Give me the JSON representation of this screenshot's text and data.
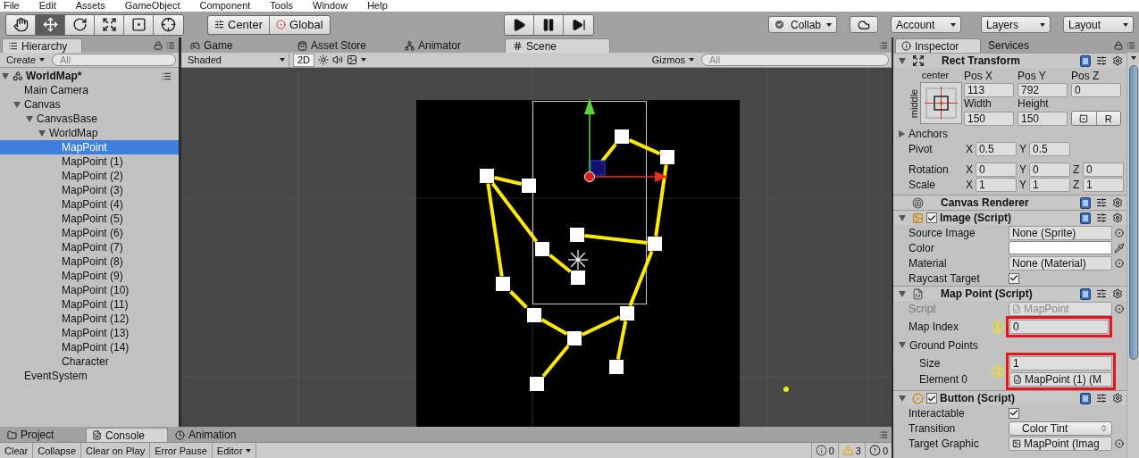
{
  "menu": [
    "File",
    "Edit",
    "Assets",
    "GameObject",
    "Component",
    "Tools",
    "Window",
    "Help"
  ],
  "toolbar": {
    "tools": [
      {
        "kind": "hand",
        "selected": false
      },
      {
        "kind": "move",
        "selected": true
      },
      {
        "kind": "rotate",
        "selected": false
      },
      {
        "kind": "scale",
        "selected": false
      },
      {
        "kind": "rect",
        "selected": false
      },
      {
        "kind": "transform",
        "selected": false
      }
    ],
    "pivot_mode": "Center",
    "pivot_rotation": "Global",
    "collab": "Collab",
    "account": "Account",
    "layers": "Layers",
    "layout": "Layout"
  },
  "hierarchy": {
    "tab": "Hierarchy",
    "create": "Create",
    "search_placeholder": "All",
    "tree": [
      {
        "label": "WorldMap*",
        "kind": "scene",
        "selected": false,
        "expanded": true,
        "children": [
          {
            "label": "Main Camera",
            "selected": false
          },
          {
            "label": "Canvas",
            "selected": false,
            "expanded": true,
            "children": [
              {
                "label": "CanvasBase",
                "selected": false,
                "expanded": true,
                "children": [
                  {
                    "label": "WorldMap",
                    "selected": false,
                    "expanded": true,
                    "children": [
                      {
                        "label": "MapPoint",
                        "selected": true
                      },
                      {
                        "label": "MapPoint (1)",
                        "selected": false
                      },
                      {
                        "label": "MapPoint (2)",
                        "selected": false
                      },
                      {
                        "label": "MapPoint (3)",
                        "selected": false
                      },
                      {
                        "label": "MapPoint (4)",
                        "selected": false
                      },
                      {
                        "label": "MapPoint (5)",
                        "selected": false
                      },
                      {
                        "label": "MapPoint (6)",
                        "selected": false
                      },
                      {
                        "label": "MapPoint (7)",
                        "selected": false
                      },
                      {
                        "label": "MapPoint (8)",
                        "selected": false
                      },
                      {
                        "label": "MapPoint (9)",
                        "selected": false
                      },
                      {
                        "label": "MapPoint (10)",
                        "selected": false
                      },
                      {
                        "label": "MapPoint (11)",
                        "selected": false
                      },
                      {
                        "label": "MapPoint (12)",
                        "selected": false
                      },
                      {
                        "label": "MapPoint (13)",
                        "selected": false
                      },
                      {
                        "label": "MapPoint (14)",
                        "selected": false
                      },
                      {
                        "label": "Character",
                        "selected": false
                      }
                    ]
                  }
                ]
              }
            ]
          },
          {
            "label": "EventSystem",
            "selected": false
          }
        ]
      }
    ]
  },
  "scene": {
    "tabs": [
      {
        "label": "Game",
        "kind": "game",
        "selected": false
      },
      {
        "label": "Asset Store",
        "kind": "store",
        "selected": false
      },
      {
        "label": "Animator",
        "kind": "animator",
        "selected": false
      },
      {
        "label": "Scene",
        "kind": "scene",
        "selected": true
      }
    ],
    "shading": "Shaded",
    "mode_2d": {
      "label": "2D",
      "on": true
    },
    "gizmos": "Gizmos",
    "search_placeholder": "All"
  },
  "inspector": {
    "tabs": [
      {
        "label": "Inspector",
        "selected": true
      },
      {
        "label": "Services",
        "selected": false
      }
    ],
    "rect_transform": {
      "title": "Rect Transform",
      "anchor_horizontal": "center",
      "anchor_vertical": "middle",
      "fields": [
        {
          "label": "Pos X",
          "value": "113"
        },
        {
          "label": "Pos Y",
          "value": "792"
        },
        {
          "label": "Pos Z",
          "value": "0"
        },
        {
          "label": "Width",
          "value": "150"
        },
        {
          "label": "Height",
          "value": "150"
        }
      ],
      "reset_button": "R",
      "anchors": {
        "label": "Anchors",
        "expanded": false
      },
      "vectors": [
        {
          "label": "Pivot",
          "axes": [
            {
              "axis": "X",
              "value": "0.5"
            },
            {
              "axis": "Y",
              "value": "0.5"
            }
          ]
        },
        {
          "label": "Rotation",
          "axes": [
            {
              "axis": "X",
              "value": "0"
            },
            {
              "axis": "Y",
              "value": "0"
            },
            {
              "axis": "Z",
              "value": "0"
            }
          ]
        },
        {
          "label": "Scale",
          "axes": [
            {
              "axis": "X",
              "value": "1"
            },
            {
              "axis": "Y",
              "value": "1"
            },
            {
              "axis": "Z",
              "value": "1"
            }
          ]
        }
      ]
    },
    "components": [
      {
        "title": "Canvas Renderer",
        "kind": "renderer"
      },
      {
        "title": "Image (Script)",
        "kind": "image",
        "enabled": true,
        "rows": [
          {
            "kind": "object",
            "label": "Source Image",
            "value": "None (Sprite)"
          },
          {
            "kind": "color",
            "label": "Color",
            "color": "#ffffff"
          },
          {
            "kind": "object",
            "label": "Material",
            "value": "None (Material)"
          },
          {
            "kind": "checkbox",
            "label": "Raycast Target",
            "checked": true
          }
        ]
      },
      {
        "title": "Map Point (Script)",
        "kind": "script",
        "rows": [
          {
            "kind": "object",
            "label": "Script",
            "value": "MapPoint",
            "disabled": true,
            "file_icon": true
          },
          {
            "kind": "number",
            "label": "Map Index",
            "value": "0",
            "highlighted": true,
            "note": "①"
          },
          {
            "kind": "group",
            "label": "Ground Points",
            "expanded": true,
            "highlighted": true,
            "note": "②",
            "children": [
              {
                "kind": "number",
                "label": "Size",
                "value": "1"
              },
              {
                "kind": "object",
                "label": "Element 0",
                "value": "MapPoint (1) (M",
                "file_icon": true
              }
            ]
          }
        ]
      },
      {
        "title": "Button (Script)",
        "kind": "button",
        "enabled": true,
        "rows": [
          {
            "kind": "checkbox",
            "label": "Interactable",
            "checked": true
          },
          {
            "kind": "dropdown",
            "label": "Transition",
            "value": "Color Tint"
          },
          {
            "kind": "object",
            "label": "Target Graphic",
            "value": "MapPoint (Imag",
            "image_icon": true
          }
        ]
      }
    ]
  },
  "bottom": {
    "tabs": [
      {
        "label": "Project",
        "kind": "project",
        "selected": false
      },
      {
        "label": "Console",
        "kind": "console",
        "selected": true
      },
      {
        "label": "Animation",
        "kind": "animation",
        "selected": false
      }
    ],
    "buttons": [
      "Clear",
      "Collapse",
      "Clear on Play",
      "Error Pause"
    ],
    "editor": "Editor",
    "counts": [
      {
        "kind": "info",
        "count": "0"
      },
      {
        "kind": "warning",
        "count": "3"
      },
      {
        "kind": "error",
        "count": "0"
      }
    ]
  }
}
